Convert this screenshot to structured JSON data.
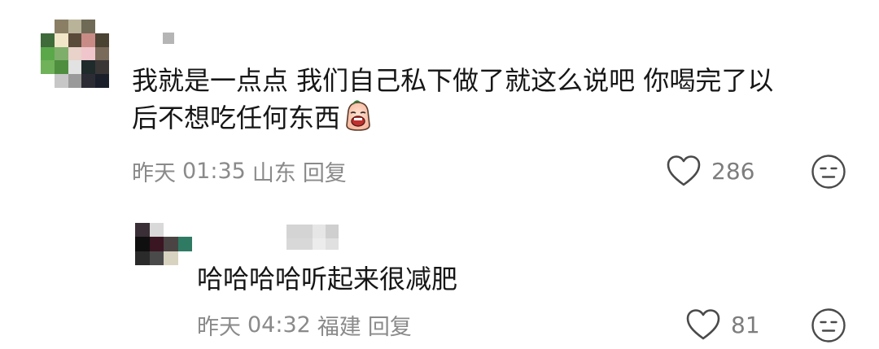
{
  "comments": [
    {
      "text_line1": "我就是一点点 我们自己私下做了就这么说吧 你喝完了以",
      "text_line2": "后不想吃任何东西",
      "emoji_icon": "crying-face-emoji-icon",
      "date": "昨天",
      "time": "01:35",
      "location": "山东",
      "reply_label": "回复",
      "like_count": "286",
      "like_icon": "heart-outline-icon",
      "dislike_icon": "unamused-face-icon"
    },
    {
      "text": "哈哈哈哈听起来很减肥",
      "date": "昨天",
      "time": "04:32",
      "location": "福建",
      "reply_label": "回复",
      "like_count": "81",
      "like_icon": "heart-outline-icon",
      "dislike_icon": "unamused-face-icon"
    }
  ],
  "colors": {
    "text": "#161616",
    "meta": "#8a8a8a",
    "icon": "#4a4a4a"
  }
}
